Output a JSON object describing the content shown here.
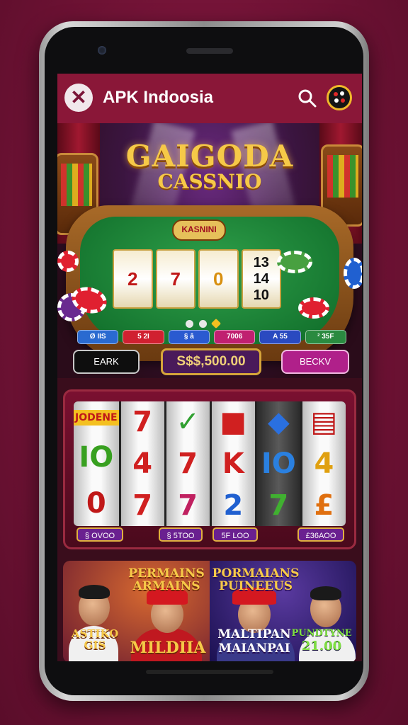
{
  "app": {
    "title": "APK Indoosia"
  },
  "hero": {
    "title_line1": "GAIGODA",
    "title_line2": "CASSNIO",
    "table_sign": "KASNINI",
    "reels": [
      {
        "top": "",
        "mid": "2",
        "bottom": ""
      },
      {
        "top": "",
        "mid": "7",
        "bottom": ""
      },
      {
        "top": "",
        "mid": "0",
        "bottom": ""
      },
      {
        "top": "13",
        "mid": "14",
        "bottom": "10"
      }
    ],
    "badges": [
      "Ø IIS",
      "5 2I",
      "§ â",
      "7006",
      "A 55",
      "² 35F"
    ],
    "earn_label": "EARK",
    "amount": "S$$,500.00",
    "beck_label": "BECKV"
  },
  "slot": {
    "reels": [
      [
        "JODENE",
        "IO",
        "0"
      ],
      [
        "7",
        "4",
        "7"
      ],
      [
        "✓",
        "7",
        "7"
      ],
      [
        "■",
        "K",
        "2"
      ],
      [
        "◆",
        "IO",
        "7"
      ],
      [
        "▤",
        "4",
        "£"
      ]
    ],
    "labels": [
      "§ OVOO",
      "§ 5TOO",
      "5F LOO",
      "£36AOO"
    ]
  },
  "banner": {
    "left_title_1": "PERMAINS",
    "left_title_2": "ARMAINS",
    "left_caption": "MILDIIA",
    "left_side_text_1": "ASTIKO",
    "left_side_text_2": "GIS",
    "right_title_1": "PORMAIANS",
    "right_title_2": "PUINEEUS",
    "right_caption_1": "MALTIPAN",
    "right_caption_2": "MAIANPAI",
    "right_side_text_1": "PUNDTYNE",
    "right_side_text_2": "21.00"
  },
  "icons": {
    "close": "close-icon",
    "search": "search-icon",
    "logo": "app-logo-icon"
  },
  "colors": {
    "accent": "#8a1738",
    "gold": "#f6c948",
    "background": "#7a1438"
  }
}
